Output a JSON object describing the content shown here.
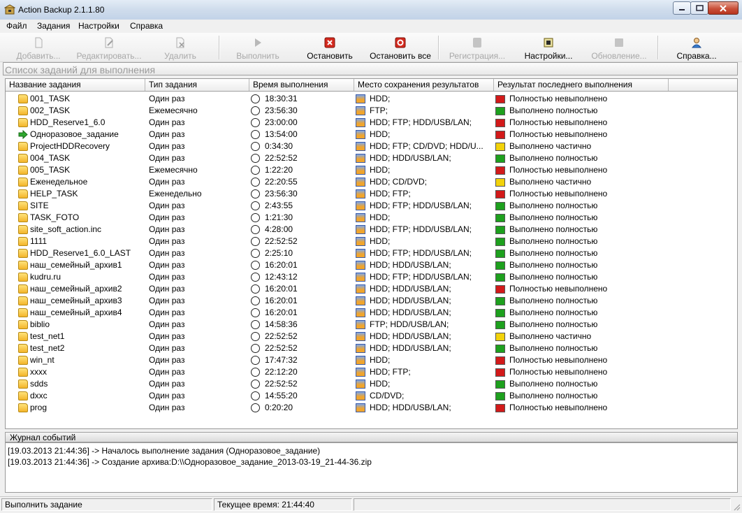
{
  "window": {
    "title": "Action Backup 2.1.1.80"
  },
  "menu": [
    "Файл",
    "Задания",
    "Настройки",
    "Справка"
  ],
  "toolbar": [
    {
      "label": "Добавить...",
      "icon": "add-icon",
      "enabled": false
    },
    {
      "label": "Редактировать...",
      "icon": "edit-icon",
      "enabled": false
    },
    {
      "label": "Удалить",
      "icon": "delete-icon",
      "enabled": false
    },
    {
      "label": "Выполнить",
      "icon": "run-icon",
      "enabled": false
    },
    {
      "label": "Остановить",
      "icon": "stop-icon",
      "enabled": true
    },
    {
      "label": "Остановить все",
      "icon": "stop-all-icon",
      "enabled": true
    },
    {
      "label": "Регистрация...",
      "icon": "register-icon",
      "enabled": false
    },
    {
      "label": "Настройки...",
      "icon": "settings-icon",
      "enabled": true
    },
    {
      "label": "Обновление...",
      "icon": "update-icon",
      "enabled": false
    },
    {
      "label": "Справка...",
      "icon": "help-icon",
      "enabled": true
    }
  ],
  "list_caption": "Список заданий для выполнения",
  "columns": [
    "Название задания",
    "Тип задания",
    "Время выполнения",
    "Место сохранения результатов",
    "Результат последнего выполнения"
  ],
  "status_colors": {
    "red": "#d21a1a",
    "green": "#1ea01e",
    "yellow": "#f2d20a"
  },
  "rows": [
    {
      "name": "001_TASK",
      "type": "Один раз",
      "time": "18:30:31",
      "storage": "HDD;",
      "result": "Полностью невыполнено",
      "status": "red"
    },
    {
      "name": "002_TASK",
      "type": "Ежемесячно",
      "time": "23:56:30",
      "storage": "FTP;",
      "result": "Выполнено полностью",
      "status": "green"
    },
    {
      "name": "HDD_Reserve1_6.0",
      "type": "Один раз",
      "time": "23:00:00",
      "storage": "HDD;  FTP;  HDD/USB/LAN;",
      "result": "Полностью невыполнено",
      "status": "red"
    },
    {
      "name": "Одноразовое_задание",
      "type": "Один раз",
      "time": "13:54:00",
      "storage": "HDD;",
      "result": "Полностью невыполнено",
      "status": "red",
      "running": true
    },
    {
      "name": "ProjectHDDRecovery",
      "type": "Один раз",
      "time": "0:34:30",
      "storage": "HDD;  FTP;  CD/DVD;  HDD/U...",
      "result": "Выполнено частично",
      "status": "yellow"
    },
    {
      "name": "004_TASK",
      "type": "Один раз",
      "time": "22:52:52",
      "storage": "HDD;  HDD/USB/LAN;",
      "result": "Выполнено полностью",
      "status": "green"
    },
    {
      "name": "005_TASK",
      "type": "Ежемесячно",
      "time": "1:22:20",
      "storage": "HDD;",
      "result": "Полностью невыполнено",
      "status": "red"
    },
    {
      "name": "Еженедельное",
      "type": "Один раз",
      "time": "22:20:55",
      "storage": "HDD;  CD/DVD;",
      "result": "Выполнено частично",
      "status": "yellow"
    },
    {
      "name": "HELP_TASK",
      "type": "Еженедельно",
      "time": "23:56:30",
      "storage": "HDD;  FTP;",
      "result": "Полностью невыполнено",
      "status": "red"
    },
    {
      "name": "SITE",
      "type": "Один раз",
      "time": "2:43:55",
      "storage": "HDD;  FTP;  HDD/USB/LAN;",
      "result": "Выполнено полностью",
      "status": "green"
    },
    {
      "name": "TASK_FOTO",
      "type": "Один раз",
      "time": "1:21:30",
      "storage": "HDD;",
      "result": "Выполнено полностью",
      "status": "green"
    },
    {
      "name": "site_soft_action.inc",
      "type": "Один раз",
      "time": "4:28:00",
      "storage": "HDD;  FTP;  HDD/USB/LAN;",
      "result": "Выполнено полностью",
      "status": "green"
    },
    {
      "name": "1111",
      "type": "Один раз",
      "time": "22:52:52",
      "storage": "HDD;",
      "result": "Выполнено полностью",
      "status": "green"
    },
    {
      "name": "HDD_Reserve1_6.0_LAST",
      "type": "Один раз",
      "time": "2:25:10",
      "storage": "HDD;  FTP;  HDD/USB/LAN;",
      "result": "Выполнено полностью",
      "status": "green"
    },
    {
      "name": "наш_семейный_архив1",
      "type": "Один раз",
      "time": "16:20:01",
      "storage": "HDD;  HDD/USB/LAN;",
      "result": "Выполнено полностью",
      "status": "green"
    },
    {
      "name": "kudru.ru",
      "type": "Один раз",
      "time": "12:43:12",
      "storage": "HDD;  FTP;  HDD/USB/LAN;",
      "result": "Выполнено полностью",
      "status": "green"
    },
    {
      "name": "наш_семейный_архив2",
      "type": "Один раз",
      "time": "16:20:01",
      "storage": "HDD;  HDD/USB/LAN;",
      "result": "Полностью невыполнено",
      "status": "red"
    },
    {
      "name": "наш_семейный_архив3",
      "type": "Один раз",
      "time": "16:20:01",
      "storage": "HDD;  HDD/USB/LAN;",
      "result": "Выполнено полностью",
      "status": "green"
    },
    {
      "name": "наш_семейный_архив4",
      "type": "Один раз",
      "time": "16:20:01",
      "storage": "HDD;  HDD/USB/LAN;",
      "result": "Выполнено полностью",
      "status": "green"
    },
    {
      "name": "biblio",
      "type": "Один раз",
      "time": "14:58:36",
      "storage": "FTP;  HDD/USB/LAN;",
      "result": "Выполнено полностью",
      "status": "green"
    },
    {
      "name": "test_net1",
      "type": "Один раз",
      "time": "22:52:52",
      "storage": "HDD;  HDD/USB/LAN;",
      "result": "Выполнено частично",
      "status": "yellow"
    },
    {
      "name": "test_net2",
      "type": "Один раз",
      "time": "22:52:52",
      "storage": "HDD;  HDD/USB/LAN;",
      "result": "Выполнено полностью",
      "status": "green"
    },
    {
      "name": "win_nt",
      "type": "Один раз",
      "time": "17:47:32",
      "storage": "HDD;",
      "result": "Полностью невыполнено",
      "status": "red"
    },
    {
      "name": "xxxx",
      "type": "Один раз",
      "time": "22:12:20",
      "storage": "HDD;  FTP;",
      "result": "Полностью невыполнено",
      "status": "red"
    },
    {
      "name": "sdds",
      "type": "Один раз",
      "time": "22:52:52",
      "storage": "HDD;",
      "result": "Выполнено полностью",
      "status": "green"
    },
    {
      "name": "dxxc",
      "type": "Один раз",
      "time": "14:55:20",
      "storage": "CD/DVD;",
      "result": "Выполнено полностью",
      "status": "green"
    },
    {
      "name": "prog",
      "type": "Один раз",
      "time": "0:20:20",
      "storage": "HDD;  HDD/USB/LAN;",
      "result": "Полностью невыполнено",
      "status": "red"
    }
  ],
  "journal": {
    "title": "Журнал событий",
    "lines": [
      "[19.03.2013 21:44:36] -> Началось выполнение задания (Одноразовое_задание)",
      "[19.03.2013 21:44:36] -> Создание архива:D:\\\\Одноразовое_задание_2013-03-19_21-44-36.zip"
    ]
  },
  "statusbar": {
    "left": "Выполнить задание",
    "time": "Текущее время: 21:44:40"
  }
}
